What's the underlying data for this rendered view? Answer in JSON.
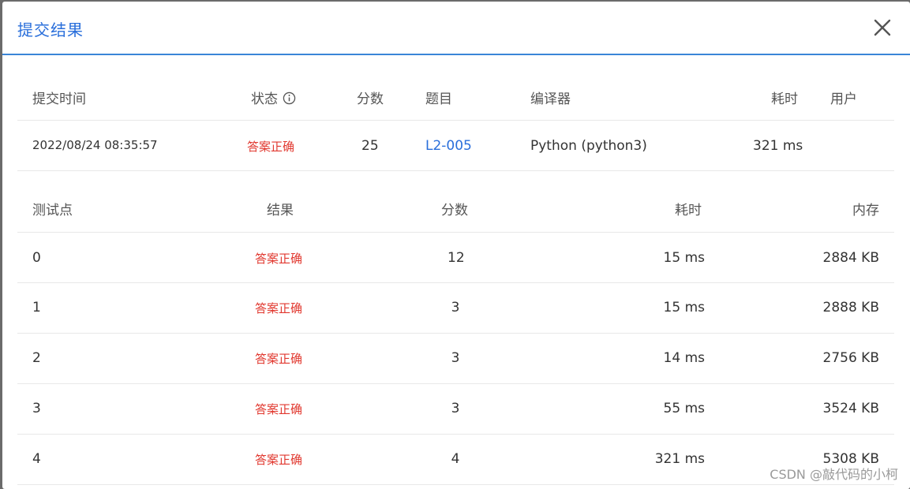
{
  "modal": {
    "title": "提交结果",
    "close_label": "×"
  },
  "submission": {
    "headers": {
      "time": "提交时间",
      "status": "状态",
      "score": "分数",
      "problem": "题目",
      "compiler": "编译器",
      "duration": "耗时",
      "user": "用户"
    },
    "row": {
      "time": "2022/08/24 08:35:57",
      "status": "答案正确",
      "score": "25",
      "problem": "L2-005",
      "compiler": "Python (python3)",
      "duration": "321 ms",
      "user": ""
    }
  },
  "testcases": {
    "headers": {
      "id": "测试点",
      "result": "结果",
      "score": "分数",
      "duration": "耗时",
      "memory": "内存"
    },
    "rows": [
      {
        "id": "0",
        "result": "答案正确",
        "score": "12",
        "duration": "15 ms",
        "memory": "2884 KB"
      },
      {
        "id": "1",
        "result": "答案正确",
        "score": "3",
        "duration": "15 ms",
        "memory": "2888 KB"
      },
      {
        "id": "2",
        "result": "答案正确",
        "score": "3",
        "duration": "14 ms",
        "memory": "2756 KB"
      },
      {
        "id": "3",
        "result": "答案正确",
        "score": "3",
        "duration": "55 ms",
        "memory": "3524 KB"
      },
      {
        "id": "4",
        "result": "答案正确",
        "score": "4",
        "duration": "321 ms",
        "memory": "5308 KB"
      }
    ]
  },
  "watermark": "CSDN @敲代码的小柯",
  "colors": {
    "accent": "#2a6fdb",
    "success_text": "#e1382f"
  }
}
